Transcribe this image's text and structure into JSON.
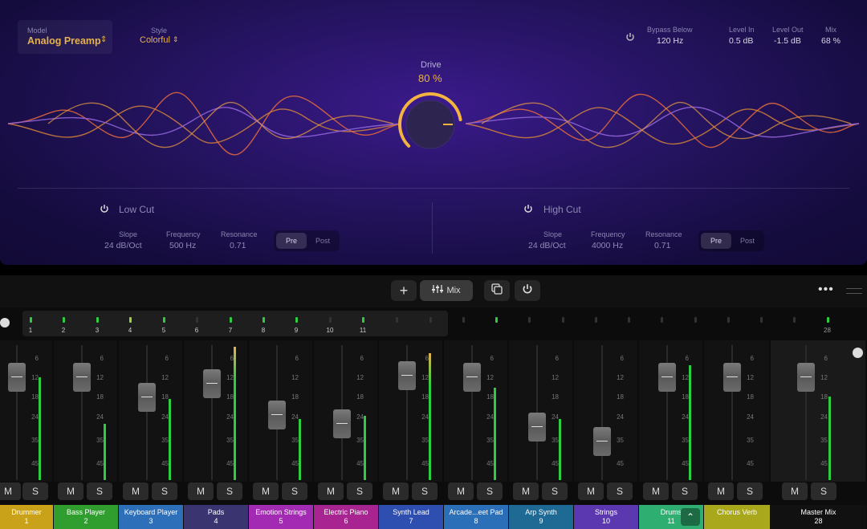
{
  "plugin": {
    "model": {
      "label": "Model",
      "value": "Analog Preamp"
    },
    "style": {
      "label": "Style",
      "value": "Colorful"
    },
    "bypass_below": {
      "label": "Bypass Below",
      "value": "120 Hz"
    },
    "level_in": {
      "label": "Level In",
      "value": "0.5 dB"
    },
    "level_out": {
      "label": "Level Out",
      "value": "-1.5 dB"
    },
    "mix": {
      "label": "Mix",
      "value": "68 %"
    },
    "drive": {
      "label": "Drive",
      "value": "80 %",
      "level": 0.8
    },
    "low_cut": {
      "title": "Low Cut",
      "slope": {
        "label": "Slope",
        "value": "24 dB/Oct"
      },
      "frequency": {
        "label": "Frequency",
        "value": "500 Hz"
      },
      "resonance": {
        "label": "Resonance",
        "value": "0.71"
      },
      "pre": "Pre",
      "post": "Post"
    },
    "high_cut": {
      "title": "High Cut",
      "slope": {
        "label": "Slope",
        "value": "24 dB/Oct"
      },
      "frequency": {
        "label": "Frequency",
        "value": "4000 Hz"
      },
      "resonance": {
        "label": "Resonance",
        "value": "0.71"
      },
      "pre": "Pre",
      "post": "Post"
    },
    "accent_color": "#e6b14c"
  },
  "toolbar": {
    "mix_label": "Mix"
  },
  "overview": {
    "numbers": [
      "1",
      "2",
      "3",
      "4",
      "5",
      "6",
      "7",
      "8",
      "9",
      "10",
      "11"
    ],
    "master_number": "28"
  },
  "scale": [
    "6",
    "12",
    "18",
    "24",
    "35",
    "45"
  ],
  "channels": [
    {
      "name": "Drummer",
      "num": "1",
      "color": "#c9a21a",
      "m": "M",
      "s": "S"
    },
    {
      "name": "Bass Player",
      "num": "2",
      "color": "#2f9e2f",
      "m": "M",
      "s": "S"
    },
    {
      "name": "Keyboard Player",
      "num": "3",
      "color": "#2d6fb8",
      "m": "M",
      "s": "S"
    },
    {
      "name": "Pads",
      "num": "4",
      "color": "#3a3470",
      "m": "M",
      "s": "S"
    },
    {
      "name": "Emotion Strings",
      "num": "5",
      "color": "#a32ab3",
      "m": "M",
      "s": "S"
    },
    {
      "name": "Electric Piano",
      "num": "6",
      "color": "#a82591",
      "m": "M",
      "s": "S"
    },
    {
      "name": "Synth Lead",
      "num": "7",
      "color": "#2f4fb0",
      "m": "M",
      "s": "S"
    },
    {
      "name": "Arcade...eet Pad",
      "num": "8",
      "color": "#2b6fb8",
      "m": "M",
      "s": "S"
    },
    {
      "name": "Arp Synth",
      "num": "9",
      "color": "#1f6a95",
      "m": "M",
      "s": "S"
    },
    {
      "name": "Strings",
      "num": "10",
      "color": "#5c38b0",
      "m": "M",
      "s": "S"
    },
    {
      "name": "Drums",
      "num": "11",
      "color": "#2fae72",
      "m": "M",
      "s": "S"
    },
    {
      "name": "Chorus Verb",
      "num": "",
      "color": "#a9a81c",
      "m": "M",
      "s": "S"
    },
    {
      "name": "Master Mix",
      "num": "28",
      "color": "#111111",
      "m": "M",
      "s": "S"
    }
  ]
}
